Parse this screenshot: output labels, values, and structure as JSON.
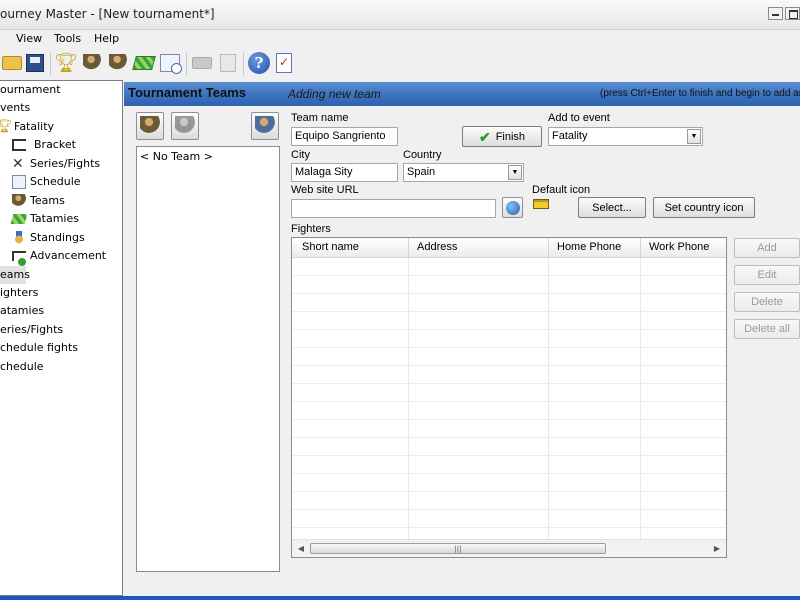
{
  "window": {
    "title": "ourney Master - [New tournament*]"
  },
  "menu": {
    "items": [
      "View",
      "Tools",
      "Help"
    ]
  },
  "toolbar": {
    "buttons": [
      "open-folder-icon",
      "save-icon",
      "trophy-icon",
      "teams-icon",
      "fighters-icon",
      "tatami-icon",
      "schedule-icon",
      "print-icon",
      "print-preview-icon",
      "help-icon",
      "report-icon"
    ]
  },
  "tree": {
    "items": [
      {
        "label": "ournament",
        "icon": "none"
      },
      {
        "label": "vents",
        "icon": "none"
      },
      {
        "label": "Fatality",
        "icon": "trophy"
      },
      {
        "label": "Bracket",
        "icon": "bracket"
      },
      {
        "label": "Series/Fights",
        "icon": "cross"
      },
      {
        "label": "Schedule",
        "icon": "calendar"
      },
      {
        "label": "Teams",
        "icon": "people"
      },
      {
        "label": "Tatamies",
        "icon": "tatami"
      },
      {
        "label": "Standings",
        "icon": "medal"
      },
      {
        "label": "Advancement",
        "icon": "advancement"
      },
      {
        "label": "eams",
        "icon": "none",
        "selected": true
      },
      {
        "label": "ighters",
        "icon": "none"
      },
      {
        "label": "atamies",
        "icon": "none"
      },
      {
        "label": "eries/Fights",
        "icon": "none"
      },
      {
        "label": "chedule fights",
        "icon": "none"
      },
      {
        "label": "chedule",
        "icon": "none"
      }
    ]
  },
  "header": {
    "title": "Tournament Teams",
    "subtitle": "Adding new team",
    "hint": "(press Ctrl+Enter to finish and begin to add another"
  },
  "teams": {
    "items": [
      "< No Team >"
    ]
  },
  "form": {
    "team_name_label": "Team name",
    "team_name_value": "Equipo Sangriento",
    "finish_label": "Finish",
    "add_to_event_label": "Add to event",
    "add_to_event_value": "Fatality",
    "city_label": "City",
    "city_value": "Malaga Sity",
    "country_label": "Country",
    "country_value": "Spain",
    "website_label": "Web site URL",
    "website_value": "",
    "default_icon_label": "Default icon",
    "select_label": "Select...",
    "set_country_icon_label": "Set country icon",
    "fighters_label": "Fighters"
  },
  "grid": {
    "columns": [
      "Short name",
      "Address",
      "Home Phone",
      "Work Phone"
    ],
    "rows": []
  },
  "side_buttons": {
    "add": "Add",
    "edit": "Edit",
    "delete": "Delete",
    "delete_all": "Delete all"
  },
  "colors": {
    "header_band": "#3b72bf",
    "accent": "#1b58b8"
  }
}
